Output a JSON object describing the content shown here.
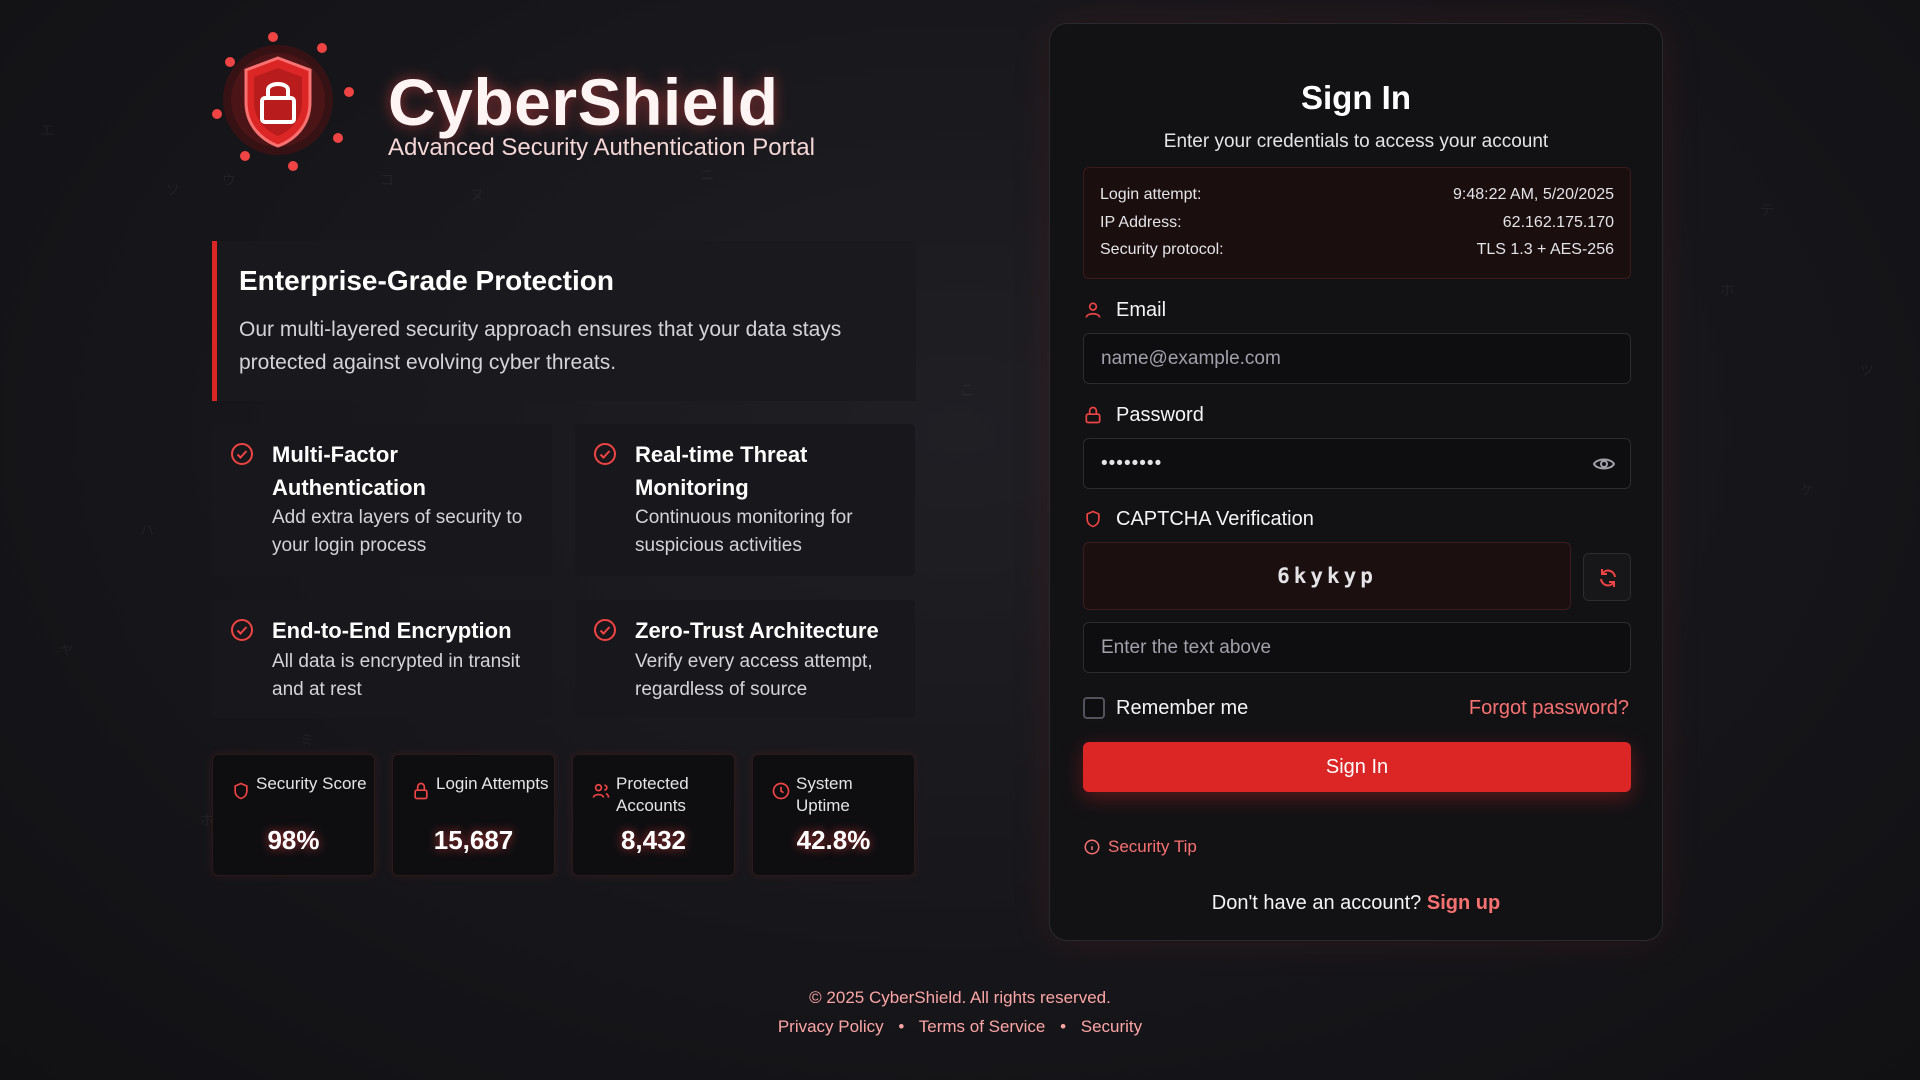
{
  "brand": {
    "name": "CyberShield",
    "tagline": "Advanced Security Authentication Portal"
  },
  "protection": {
    "title": "Enterprise-Grade Protection",
    "text": "Our multi-layered security approach ensures that your data stays protected against evolving cyber threats."
  },
  "features": [
    {
      "title": "Multi-Factor Authentication",
      "text": "Add extra layers of security to your login process",
      "icon": "check-circle-icon"
    },
    {
      "title": "Real-time Threat Monitoring",
      "text": "Continuous monitoring for suspicious activities",
      "icon": "check-circle-icon"
    },
    {
      "title": "End-to-End Encryption",
      "text": "All data is encrypted in transit and at rest",
      "icon": "check-circle-icon"
    },
    {
      "title": "Zero-Trust Architecture",
      "text": "Verify every access attempt, regardless of source",
      "icon": "check-circle-icon"
    }
  ],
  "stats": [
    {
      "label": "Security Score",
      "value": "98%",
      "icon": "shield-icon"
    },
    {
      "label": "Login Attempts",
      "value": "15,687",
      "icon": "lock-icon"
    },
    {
      "label": "Protected Accounts",
      "value": "8,432",
      "icon": "users-icon"
    },
    {
      "label": "System Uptime",
      "value": "42.8%",
      "icon": "clock-icon"
    }
  ],
  "signin": {
    "title": "Sign In",
    "subtitle": "Enter your credentials to access your account",
    "info": [
      {
        "key": "Login attempt:",
        "value": "9:48:22 AM, 5/20/2025"
      },
      {
        "key": "IP Address:",
        "value": "62.162.175.170"
      },
      {
        "key": "Security protocol:",
        "value": "TLS 1.3 + AES-256"
      }
    ],
    "email_label": "Email",
    "email_placeholder": "name@example.com",
    "password_label": "Password",
    "password_value": "••••••••",
    "captcha_label": "CAPTCHA Verification",
    "captcha_code": "6kykyp",
    "captcha_placeholder": "Enter the text above",
    "remember_label": "Remember me",
    "forgot_label": "Forgot password?",
    "button_label": "Sign In",
    "tip_label": "Security Tip",
    "no_account": "Don't have an account?",
    "signup_label": "Sign up"
  },
  "footer": {
    "copyright": "© 2025 CyberShield. All rights reserved.",
    "links": [
      "Privacy Policy",
      "Terms of Service",
      "Security"
    ],
    "separator": "•"
  },
  "colors": {
    "accent": "#dc2626",
    "accent_light": "#f87171",
    "background": "#17171a",
    "card": "#121215"
  }
}
